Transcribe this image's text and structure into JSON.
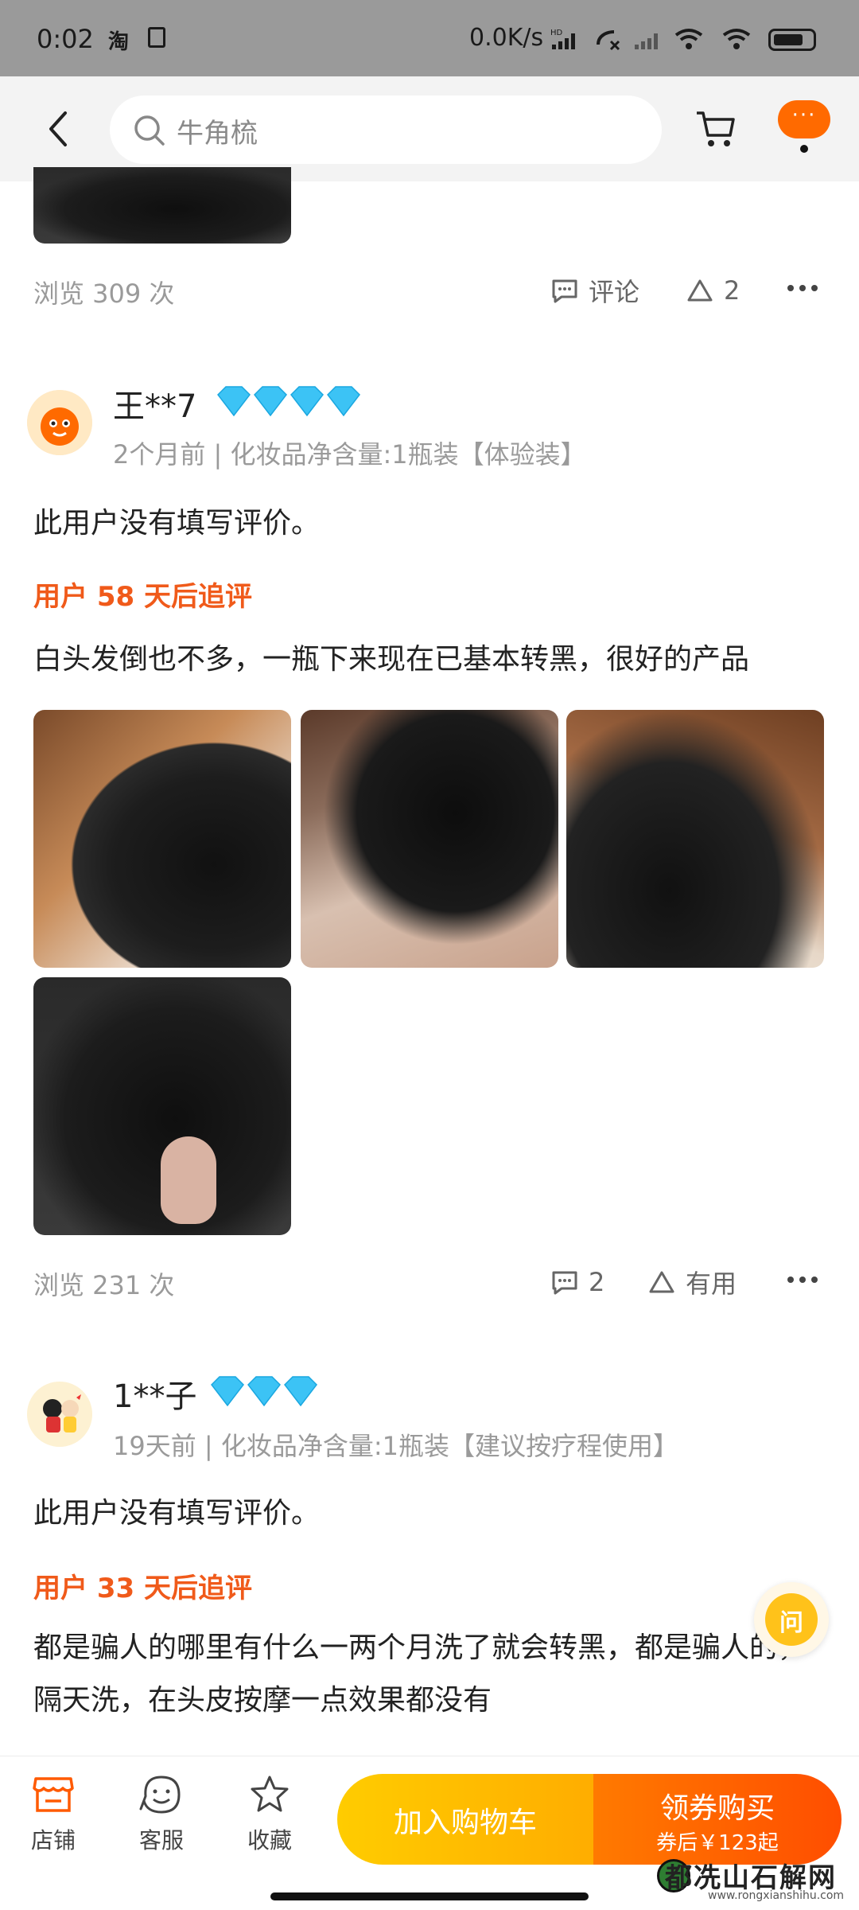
{
  "status_bar": {
    "time": "0:02",
    "app_indicator": "淘",
    "network_speed": "0.0K/s"
  },
  "header": {
    "search_text": "牛角梳"
  },
  "review_prev": {
    "views": "浏览 309 次",
    "comment_label": "评论",
    "like_count": "2"
  },
  "review_1": {
    "username": "王**7",
    "diamonds": 4,
    "meta": "2个月前 | 化妆品净含量:1瓶装【体验装】",
    "text": "此用户没有填写评价。",
    "followup_label": "用户 58 天后追评",
    "followup_text": "白头发倒也不多，一瓶下来现在已基本转黑，很好的产品",
    "views": "浏览 231 次",
    "comment_count": "2",
    "useful_label": "有用"
  },
  "review_2": {
    "username": "1**子",
    "diamonds": 3,
    "meta": "19天前 | 化妆品净含量:1瓶装【建议按疗程使用】",
    "text": "此用户没有填写评价。",
    "followup_label": "用户 33 天后追评",
    "followup_text": "都是骗人的哪里有什么一两个月洗了就会转黑，都是骗人的，隔天洗，在头皮按摩一点效果都没有"
  },
  "float_button": {
    "label": "问"
  },
  "bottom_bar": {
    "shop_label": "店铺",
    "service_label": "客服",
    "favorite_label": "收藏",
    "add_cart_label": "加入购物车",
    "buy_label": "领券购买",
    "buy_sub_label": "券后￥123起"
  },
  "watermark": {
    "text": "都冼山石解网",
    "url": "www.rongxianshihu.com"
  },
  "colors": {
    "accent_orange": "#ff6a00",
    "followup_orange": "#f05a1a",
    "diamond_blue": "#3cc3f5",
    "add_cart_yellow": "#ffb800"
  }
}
